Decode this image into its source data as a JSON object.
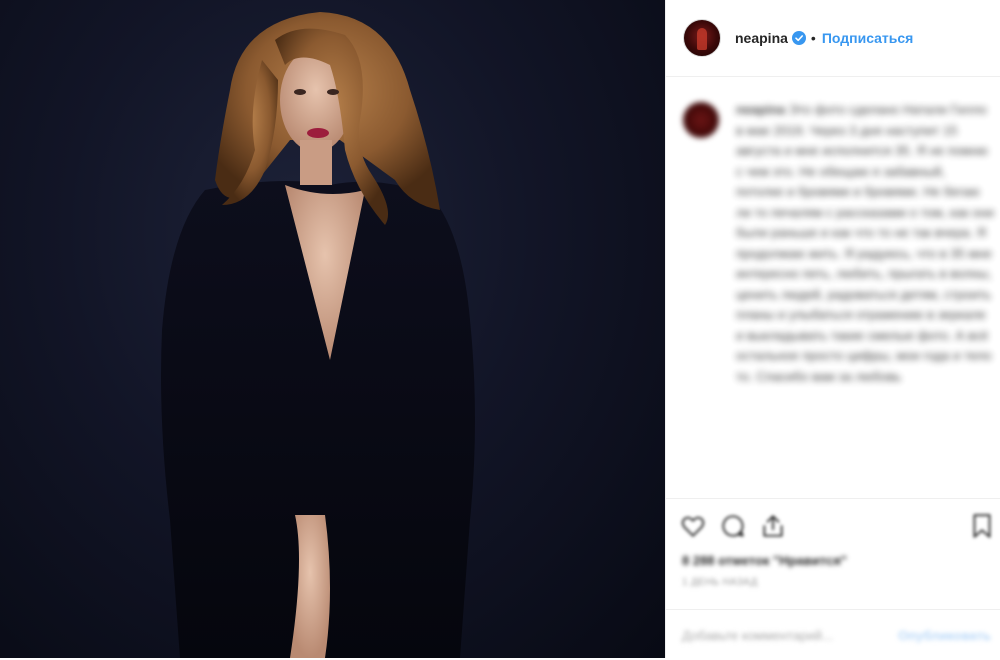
{
  "post": {
    "photo_alt": "",
    "author": {
      "username": "neapina",
      "verified": true
    },
    "separator": "•",
    "follow_label": "Подписаться"
  },
  "caption": {
    "username": "neapina",
    "text": "Это фото сделано Натали Гилло в мае 2019. Через 3 дня наступит 15 августа и мне исполнится 35. Я не помню с чем это. Не обещаю я забавный, потолке и бровями и бровями. Не бегаю ли то печалям с рассказами о том, как они были раньше и как что то не так вчера. Я продолжаю жить. Я радуюсь, что в 35 мне интересно петь, любить, прыгать в волны, ценить людей, радоваться детям, строить планы и улыбаться отражению в зеркале и выкладывать такие смелые фото. А всё остальное просто цифры, мои года и тело то. Спасибо вам за любовь"
  },
  "actions": {
    "icons": [
      "heart-icon",
      "comment-icon",
      "share-icon",
      "bookmark-icon"
    ],
    "likes": "8 288 отметок \"Нравится\"",
    "timestamp": "1 ДЕНЬ НАЗАД"
  },
  "comment_box": {
    "placeholder": "Добавьте комментарий...",
    "publish_label": "Опубликовать"
  },
  "colors": {
    "accent": "#3897f0",
    "photo_bg": "#121527",
    "text": "#262626",
    "border": "#efefef"
  }
}
